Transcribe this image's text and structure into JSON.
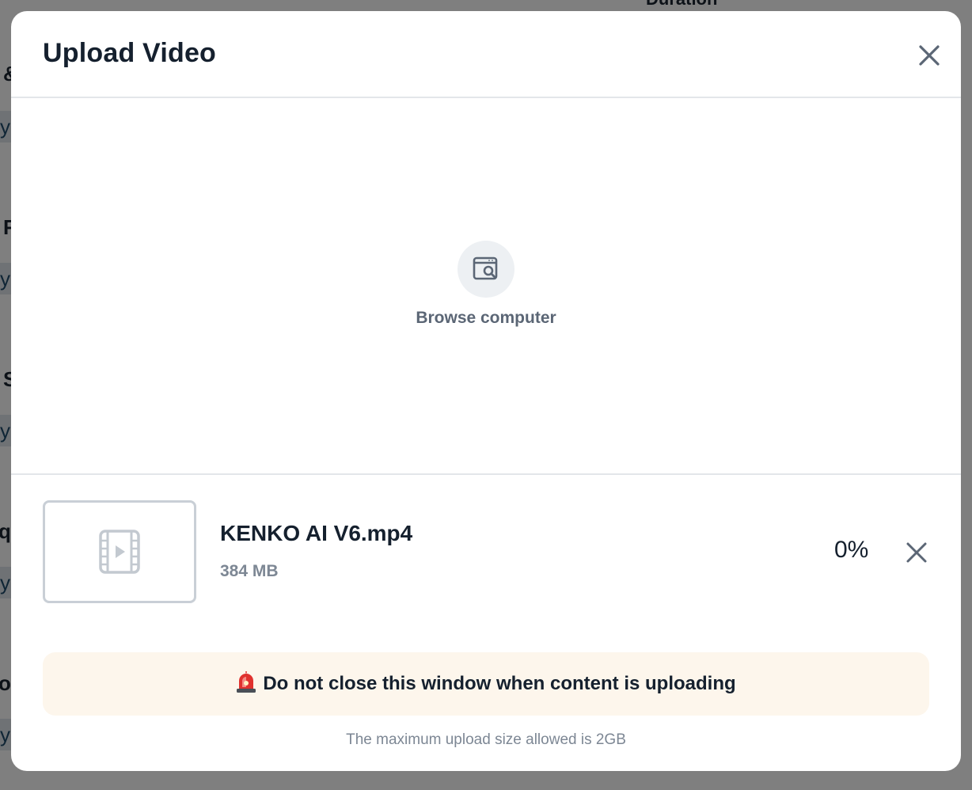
{
  "background": {
    "fragments": [
      "&",
      "yl",
      "F",
      "yl",
      "S",
      "yl",
      "qu",
      "yl",
      "o",
      "yl"
    ],
    "duration_label": "Duration"
  },
  "modal": {
    "title": "Upload Video",
    "close_icon": "close-icon"
  },
  "dropzone": {
    "browse_icon": "browser-search-icon",
    "browse_label": "Browse computer"
  },
  "file": {
    "icon": "video-file-icon",
    "name": "KENKO AI V6.mp4",
    "size": "384 MB",
    "progress_label": "0%",
    "progress": 0,
    "remove_icon": "close-icon"
  },
  "warning": {
    "icon": "rotating-light-icon",
    "text": "Do not close this window when content is uploading",
    "background_color": "#fdf6ec"
  },
  "footer": {
    "limit_text": "The maximum upload size allowed is 2GB"
  }
}
